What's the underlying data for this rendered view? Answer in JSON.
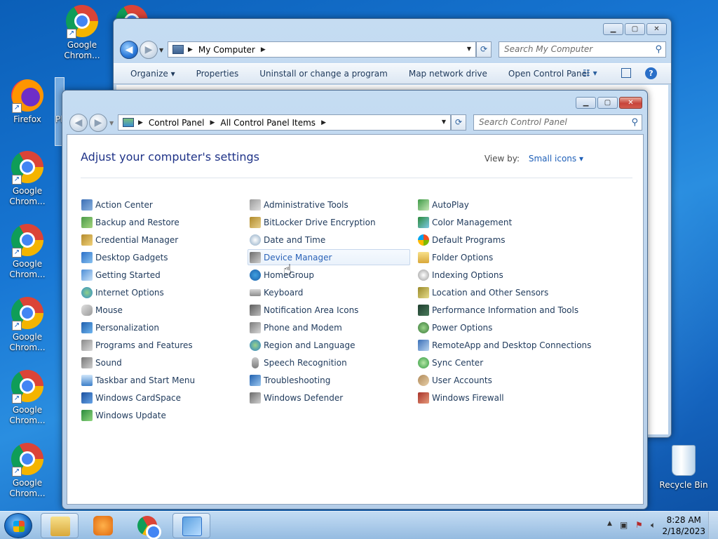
{
  "desktop": {
    "icons": [
      {
        "label": "Google Chrom...",
        "type": "chrome"
      },
      {
        "label": "Firefox",
        "type": "firefox"
      },
      {
        "label": "Google Chrom...",
        "type": "chrome"
      },
      {
        "label": "Google Chrom...",
        "type": "chrome"
      },
      {
        "label": "Google Chrom...",
        "type": "chrome"
      },
      {
        "label": "Google Chrom...",
        "type": "chrome"
      },
      {
        "label": "Google Chrom...",
        "type": "chrome"
      }
    ],
    "recycle_bin": "Recycle Bin",
    "partial_icon": "Pl"
  },
  "my_computer": {
    "address": [
      "My Computer"
    ],
    "search_placeholder": "Search My Computer",
    "commands": [
      "Organize",
      "Properties",
      "Uninstall or change a program",
      "Map network drive",
      "Open Control Panel"
    ]
  },
  "control_panel": {
    "address": [
      "Control Panel",
      "All Control Panel Items"
    ],
    "search_placeholder": "Search Control Panel",
    "heading": "Adjust your computer's settings",
    "view_by_label": "View by:",
    "view_by_value": "Small icons",
    "columns": [
      [
        "Action Center",
        "Backup and Restore",
        "Credential Manager",
        "Desktop Gadgets",
        "Getting Started",
        "Internet Options",
        "Mouse",
        "Personalization",
        "Programs and Features",
        "Sound",
        "Taskbar and Start Menu",
        "Windows CardSpace",
        "Windows Update"
      ],
      [
        "Administrative Tools",
        "BitLocker Drive Encryption",
        "Date and Time",
        "Device Manager",
        "HomeGroup",
        "Keyboard",
        "Notification Area Icons",
        "Phone and Modem",
        "Region and Language",
        "Speech Recognition",
        "Troubleshooting",
        "Windows Defender"
      ],
      [
        "AutoPlay",
        "Color Management",
        "Default Programs",
        "Folder Options",
        "Indexing Options",
        "Location and Other Sensors",
        "Performance Information and Tools",
        "Power Options",
        "RemoteApp and Desktop Connections",
        "Sync Center",
        "User Accounts",
        "Windows Firewall"
      ]
    ],
    "hovered_item": "Device Manager"
  },
  "taskbar": {
    "time": "8:28 AM",
    "date": "2/18/2023",
    "buttons": [
      "explorer",
      "media-player",
      "chrome",
      "control-panel"
    ]
  },
  "colors": {
    "link": "#1e395b",
    "heading": "#1e3287",
    "hover_link": "#2b63b8"
  }
}
